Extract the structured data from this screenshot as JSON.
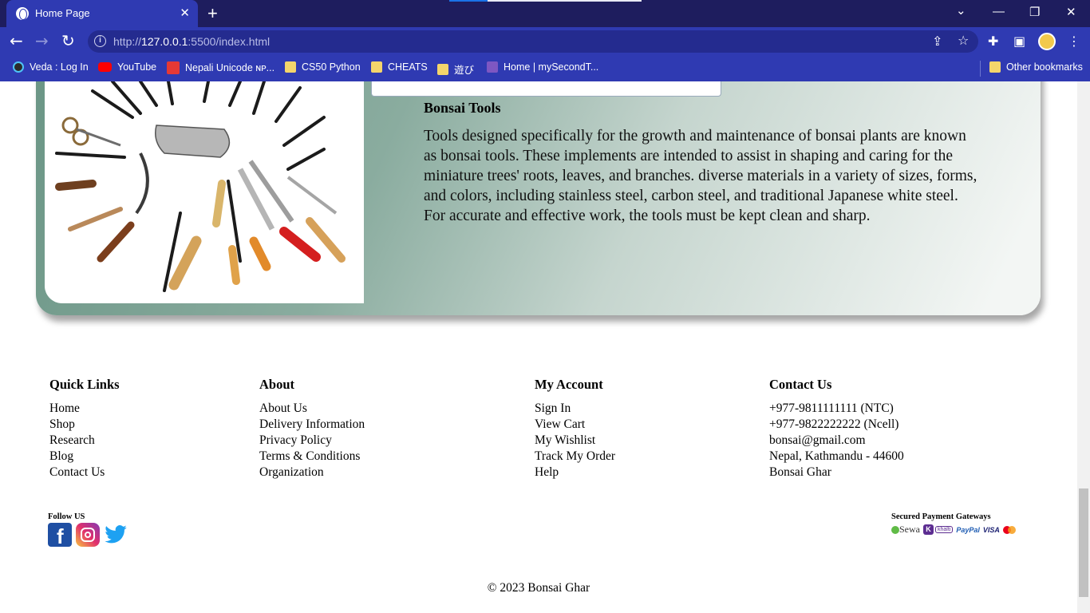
{
  "browser": {
    "tab_title": "Home Page",
    "url_prefix": "http://",
    "url_host": "127.0.0.1",
    "url_rest": ":5500/index.html",
    "bookmarks": [
      {
        "label": "Veda : Log In"
      },
      {
        "label": "YouTube"
      },
      {
        "label": "Nepali Unicode ɴᴘ..."
      },
      {
        "label": "CS50 Python"
      },
      {
        "label": "CHEATS"
      },
      {
        "label": "遊び"
      },
      {
        "label": "Home | mySecondT..."
      }
    ],
    "other_bookmarks": "Other bookmarks"
  },
  "product": {
    "title": "Bonsai Tools",
    "description": "Tools designed specifically for the growth and maintenance of bonsai plants are known as bonsai tools. These implements are intended to assist in shaping and caring for the miniature trees' roots, leaves, and branches. diverse materials in a variety of sizes, forms, and colors, including stainless steel, carbon steel, and traditional Japanese white steel. For accurate and effective work, the tools must be kept clean and sharp."
  },
  "footer": {
    "quick_links": {
      "heading": "Quick Links",
      "items": [
        "Home",
        "Shop",
        "Research",
        "Blog",
        "Contact Us"
      ]
    },
    "about": {
      "heading": "About",
      "items": [
        "About Us",
        "Delivery Information",
        "Privacy Policy",
        "Terms & Conditions",
        "Organization"
      ]
    },
    "account": {
      "heading": "My Account",
      "items": [
        "Sign In",
        "View Cart",
        "My Wishlist",
        "Track My Order",
        "Help"
      ]
    },
    "contact": {
      "heading": "Contact Us",
      "items": [
        "+977-9811111111 (NTC)",
        "+977-9822222222 (Ncell)",
        "bonsai@gmail.com",
        "Nepal, Kathmandu - 44600",
        "Bonsai Ghar"
      ]
    },
    "follow_label": "Follow US",
    "payment_label": "Secured Payment Gateways",
    "payment_brands": {
      "esewa": "Sewa",
      "khalti": "khalti",
      "paypal": "PayPal",
      "visa": "VISA"
    },
    "copyright": "© 2023 Bonsai Ghar"
  },
  "colors": {
    "chrome_dark": "#1e1d5e",
    "chrome": "#2f3ab2",
    "card_start": "#6a9585",
    "card_end": "#f3f6f4"
  }
}
